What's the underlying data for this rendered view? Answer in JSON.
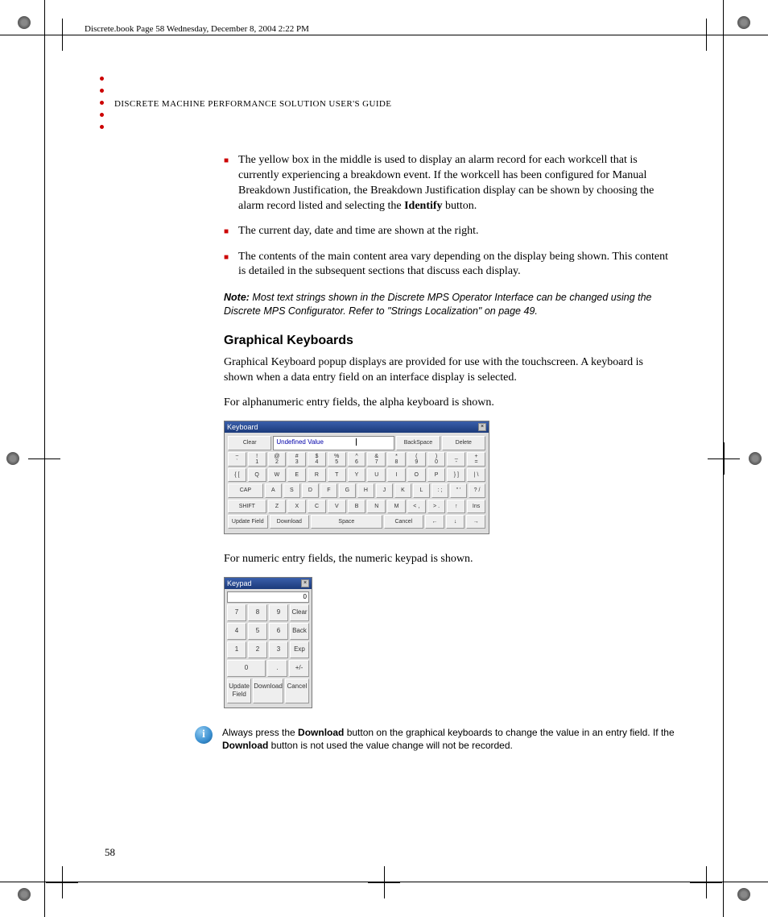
{
  "header": {
    "file_info": "Discrete.book  Page 58  Wednesday, December 8, 2004  2:22 PM"
  },
  "running_head": "DISCRETE MACHINE PERFORMANCE SOLUTION USER'S GUIDE",
  "bullets": [
    "The yellow box in the middle is used to display an alarm record for each workcell that is currently experiencing a breakdown event. If the workcell has been configured for Manual Breakdown Justification, the Breakdown Justification display can be shown by choosing the alarm record listed and selecting the ",
    "The current day, date and time are shown at the right.",
    "The contents of the main content area vary depending on the display being shown. This content is detailed in the subsequent sections that discuss each display."
  ],
  "bullet0_bold": "Identify",
  "bullet0_tail": " button.",
  "note": {
    "label": "Note:",
    "text": " Most text strings shown in the Discrete MPS Operator Interface can be changed using the Discrete MPS Configurator. Refer to \"Strings Localization\" on page 49."
  },
  "section_heading": "Graphical Keyboards",
  "para1": "Graphical Keyboard popup displays are provided for use with the touchscreen. A keyboard is shown when a data entry field on an interface display is selected.",
  "para2": "For alphanumeric entry fields, the alpha keyboard is shown.",
  "para3": "For numeric entry fields, the numeric keypad is shown.",
  "keyboard": {
    "title": "Keyboard",
    "field_text": "Undefined Value",
    "row_top": [
      "Clear",
      "BackSpace",
      "Delete"
    ],
    "row1_upper": [
      "~",
      "!",
      "@",
      "#",
      "$",
      "%",
      "^",
      "&",
      "*",
      "(",
      ")",
      "_",
      "+"
    ],
    "row1_lower": [
      "`",
      "1",
      "2",
      "3",
      "4",
      "5",
      "6",
      "7",
      "8",
      "9",
      "0",
      "-",
      "="
    ],
    "row2": [
      "{ [",
      "Q",
      "W",
      "E",
      "R",
      "T",
      "Y",
      "U",
      "I",
      "O",
      "P",
      "} ]",
      "| \\"
    ],
    "row3": [
      "CAP",
      "A",
      "S",
      "D",
      "F",
      "G",
      "H",
      "J",
      "K",
      "L",
      ": ;",
      "\" '",
      "? /"
    ],
    "row4": [
      "SHIFT",
      "Z",
      "X",
      "C",
      "V",
      "B",
      "N",
      "M",
      "< ,",
      "> .",
      "↑",
      "Ins"
    ],
    "row5": [
      "Update Field",
      "Download",
      "Space",
      "Cancel",
      "←",
      "↓",
      "→"
    ]
  },
  "keypad": {
    "title": "Keypad",
    "field": "0",
    "rows": [
      [
        "7",
        "8",
        "9",
        "Clear"
      ],
      [
        "4",
        "5",
        "6",
        "Back"
      ],
      [
        "1",
        "2",
        "3",
        "Exp"
      ],
      [
        "0",
        ".",
        "+/-"
      ],
      [
        "Update Field",
        "Download",
        "Cancel"
      ]
    ]
  },
  "info": {
    "pre": "Always press the ",
    "b1": "Download",
    "mid": " button on the graphical keyboards to change the value in an entry field. If the ",
    "b2": "Download",
    "post": " button is not used the value change will not be recorded."
  },
  "page_number": "58"
}
